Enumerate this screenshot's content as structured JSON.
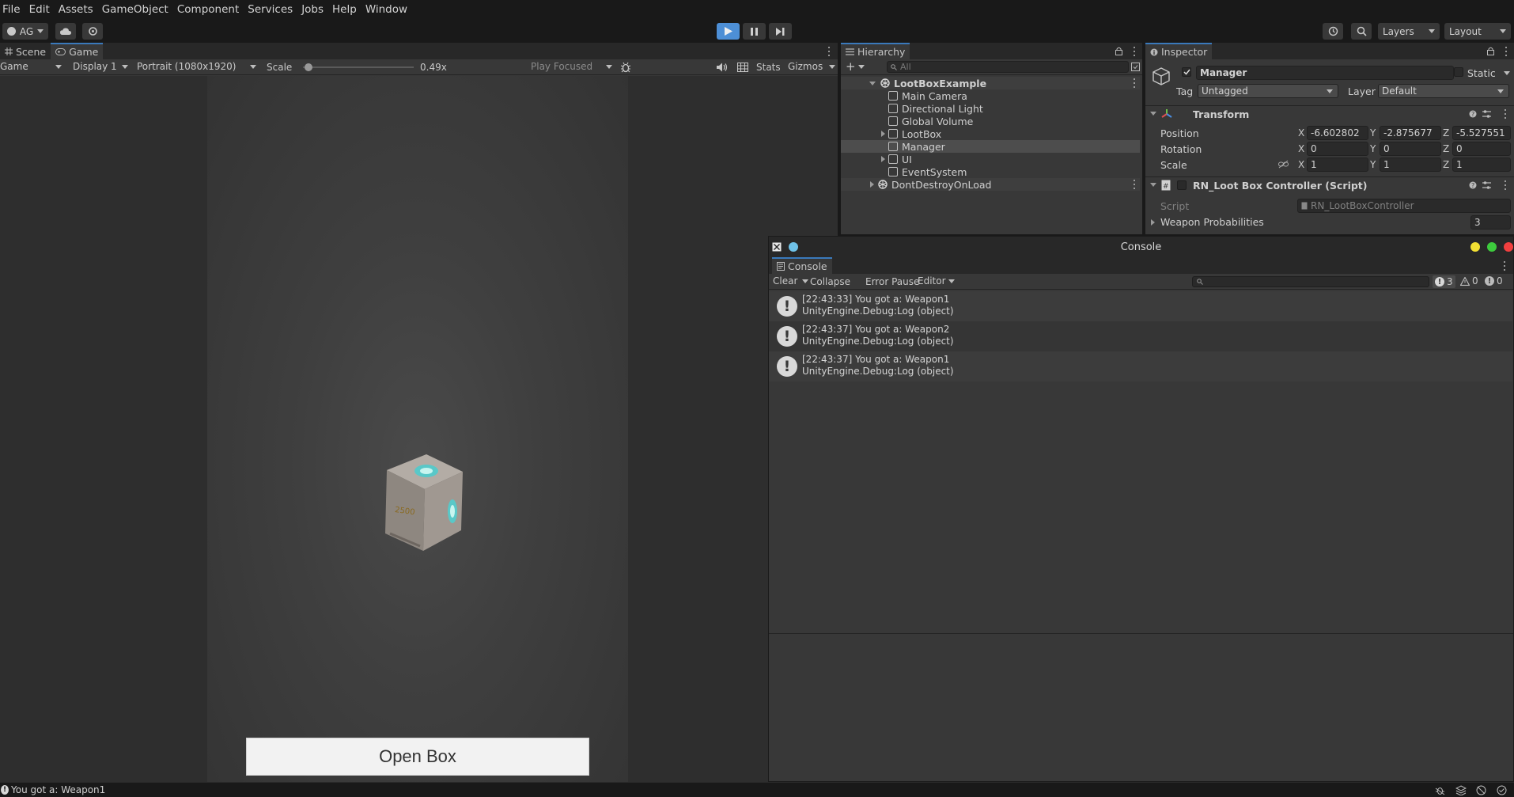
{
  "menu": [
    "File",
    "Edit",
    "Assets",
    "GameObject",
    "Component",
    "Services",
    "Jobs",
    "Help",
    "Window"
  ],
  "toolbar": {
    "account": "AG",
    "layers": "Layers",
    "layout": "Layout"
  },
  "game_view": {
    "tabs": [
      "Scene",
      "Game"
    ],
    "view_select": "Game",
    "display": "Display 1",
    "resolution": "Portrait (1080x1920)",
    "scale_label": "Scale",
    "scale_value": "0.49x",
    "scale_fraction": 0.05,
    "play_mode": "Play Focused",
    "stats": "Stats",
    "gizmos": "Gizmos",
    "box_label": "2500",
    "open_button": "Open Box"
  },
  "hierarchy": {
    "title": "Hierarchy",
    "search_placeholder": "All",
    "scene": "LootBoxExample",
    "items": [
      "Main Camera",
      "Directional Light",
      "Global Volume",
      "LootBox",
      "Manager",
      "UI",
      "EventSystem"
    ],
    "ddol": "DontDestroyOnLoad"
  },
  "inspector": {
    "title": "Inspector",
    "object_name": "Manager",
    "static_label": "Static",
    "tag_label": "Tag",
    "tag_value": "Untagged",
    "layer_label": "Layer",
    "layer_value": "Default",
    "transform_title": "Transform",
    "position_label": "Position",
    "rotation_label": "Rotation",
    "scale_label": "Scale",
    "axes": [
      "X",
      "Y",
      "Z"
    ],
    "position": [
      "-6.602802",
      "-2.875677",
      "-5.527551"
    ],
    "rotation": [
      "0",
      "0",
      "0"
    ],
    "scale": [
      "1",
      "1",
      "1"
    ],
    "script_component": "RN_Loot Box Controller (Script)",
    "script_label": "Script",
    "script_value": "RN_LootBoxController",
    "weapon_prob_label": "Weapon Probabilities",
    "weapon_prob_value": "3"
  },
  "console": {
    "window_title": "Console",
    "tab": "Console",
    "clear": "Clear",
    "collapse": "Collapse",
    "error_pause": "Error Pause",
    "editor": "Editor",
    "count_logs": "3",
    "count_warnings": "0",
    "count_errors": "0",
    "entries": [
      {
        "line1": "[22:43:33] You got a: Weapon1",
        "line2": "UnityEngine.Debug:Log (object)"
      },
      {
        "line1": "[22:43:37] You got a: Weapon2",
        "line2": "UnityEngine.Debug:Log (object)"
      },
      {
        "line1": "[22:43:37] You got a: Weapon1",
        "line2": "UnityEngine.Debug:Log (object)"
      }
    ]
  },
  "statusbar": {
    "message": "You got a: Weapon1"
  },
  "colors": {
    "accent": "#3a79bb",
    "play_active": "#4d8fd6",
    "traffic_yellow": "#f3e033",
    "traffic_green": "#3dcb3d",
    "traffic_red": "#f23f3f"
  }
}
